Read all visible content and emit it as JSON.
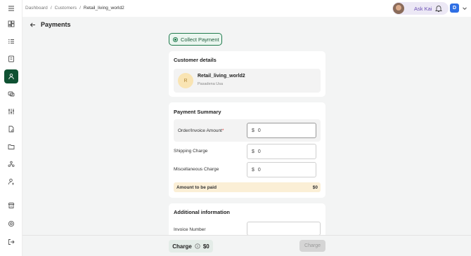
{
  "header": {
    "breadcrumb": [
      "Dashboard",
      "Customers",
      "Retail_living_world2"
    ],
    "breadcrumb_sep": "/",
    "ask_label": "Ask Kai",
    "user_initial": "D"
  },
  "page": {
    "title": "Payments",
    "collect_label": "Collect Payment"
  },
  "customer": {
    "section_title": "Customer details",
    "initial": "R",
    "name": "Retail_living_world2",
    "location": "Pasadena Usa"
  },
  "summary": {
    "section_title": "Payment Summary",
    "currency": "$",
    "rows": [
      {
        "label": "Order/Invoice Amount",
        "required": "*",
        "value": "0"
      },
      {
        "label": "Shipping Charge",
        "value": "0"
      },
      {
        "label": "Miscellaneous Charge",
        "value": "0"
      }
    ],
    "total_label": "Amount to be paid",
    "total_value": "$0"
  },
  "additional": {
    "section_title": "Additional information",
    "invoice_label": "Invoice Number",
    "invoice_value": ""
  },
  "footer": {
    "charge_label": "Charge",
    "charge_amount": "$0",
    "charge_button": "Charge"
  },
  "colors": {
    "accent": "#0f5132",
    "ask_text": "#6b4fb5",
    "user_badge": "#2f6fe4",
    "total_bg": "#fbefd6"
  },
  "sidebar_icons": [
    "menu-icon",
    "dashboard-icon",
    "list-icon",
    "orders-icon",
    "customers-icon",
    "chat-icon",
    "filters-icon",
    "document-icon",
    "folder-icon",
    "network-icon",
    "user-settings-icon",
    "store-icon",
    "settings-icon",
    "logout-icon"
  ]
}
